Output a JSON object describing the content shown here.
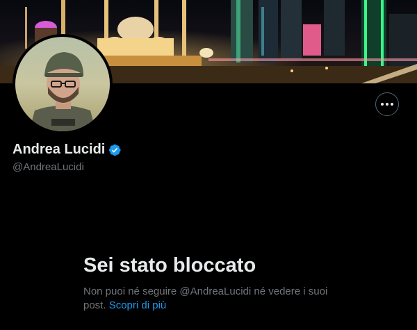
{
  "profile": {
    "display_name": "Andrea Lucidi",
    "handle": "@AndreaLucidi",
    "verified": true,
    "verified_icon": "verified-badge-icon",
    "verified_color": "#1d9bf0"
  },
  "header": {
    "banner_image": "night city skyline with mosque and illuminated towers",
    "avatar_image": "man in helmet and glasses wearing tactical vest",
    "more_icon": "more-horizontal-icon"
  },
  "blocked": {
    "title": "Sei stato bloccato",
    "body_prefix": "Non puoi né seguire @AndreaLucidi né vedere i suoi post.",
    "learn_more": "Scopri di più"
  },
  "colors": {
    "background": "#000000",
    "primary_text": "#e7e9ea",
    "secondary_text": "#71767b",
    "accent": "#1d9bf0"
  }
}
